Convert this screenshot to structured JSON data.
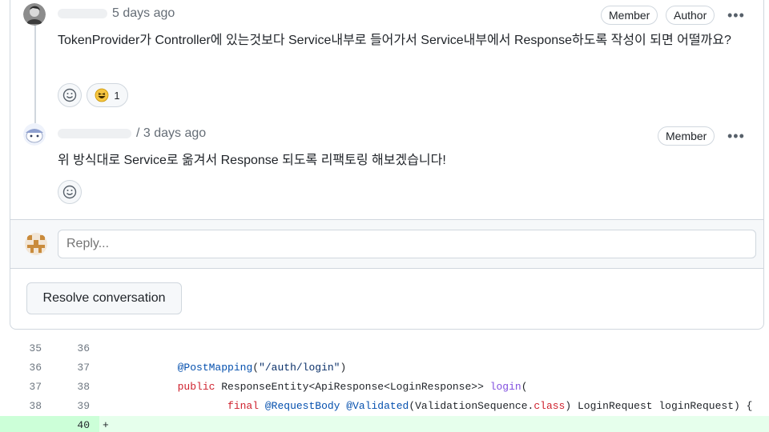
{
  "comments": [
    {
      "timestamp": "5 days ago",
      "badges": [
        "Member",
        "Author"
      ],
      "more_label": "•••",
      "body": "TokenProvider가 Controller에 있는것보다 Service내부로 들어가서 Service내부에서 Response하도록 작성이 되면 어떨까요?",
      "reactions": [
        {
          "icon": "smiley-icon",
          "count": ""
        },
        {
          "icon": "laugh-emoji",
          "count": "1"
        }
      ]
    },
    {
      "timestamp": "/ 3 days ago",
      "badges": [
        "Member"
      ],
      "more_label": "•••",
      "body": "위 방식대로 Service로 옮겨서 Response 되도록 리팩토링 해보겠습니다!",
      "reactions": [
        {
          "icon": "smiley-icon",
          "count": ""
        }
      ]
    }
  ],
  "reply": {
    "placeholder": "Reply..."
  },
  "resolve_button": "Resolve conversation",
  "diff": {
    "rows": [
      {
        "old": "35",
        "new": "36",
        "tokens": [],
        "added": false
      },
      {
        "old": "36",
        "new": "37",
        "added": false,
        "tokens": [
          {
            "t": "            ",
            "c": ""
          },
          {
            "t": "@PostMapping",
            "c": "ann"
          },
          {
            "t": "(",
            "c": ""
          },
          {
            "t": "\"/auth/login\"",
            "c": "str"
          },
          {
            "t": ")",
            "c": ""
          }
        ]
      },
      {
        "old": "37",
        "new": "38",
        "added": false,
        "tokens": [
          {
            "t": "            ",
            "c": ""
          },
          {
            "t": "public",
            "c": "kw"
          },
          {
            "t": " ResponseEntity<ApiResponse<LoginResponse>> ",
            "c": ""
          },
          {
            "t": "login",
            "c": "fn"
          },
          {
            "t": "(",
            "c": ""
          }
        ]
      },
      {
        "old": "38",
        "new": "39",
        "added": false,
        "tokens": [
          {
            "t": "                    ",
            "c": ""
          },
          {
            "t": "final",
            "c": "kw"
          },
          {
            "t": " ",
            "c": ""
          },
          {
            "t": "@RequestBody",
            "c": "ann"
          },
          {
            "t": " ",
            "c": ""
          },
          {
            "t": "@Validated",
            "c": "ann"
          },
          {
            "t": "(ValidationSequence.",
            "c": ""
          },
          {
            "t": "class",
            "c": "kw"
          },
          {
            "t": ") LoginRequest loginRequest) {",
            "c": ""
          }
        ]
      },
      {
        "old": "",
        "new": "40",
        "added": true,
        "tokens": [
          {
            "t": "+",
            "c": ""
          }
        ]
      }
    ]
  }
}
